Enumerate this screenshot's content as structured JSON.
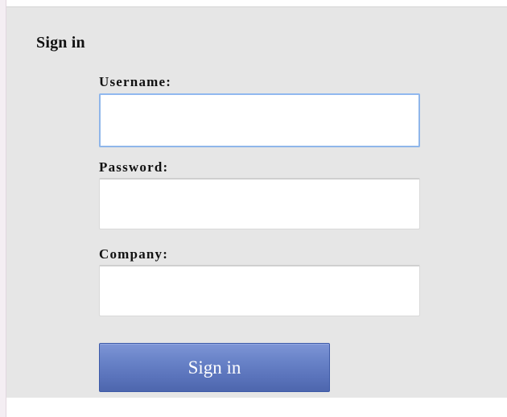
{
  "form": {
    "title": "Sign in",
    "fields": {
      "username": {
        "label": "Username:",
        "value": "",
        "placeholder": ""
      },
      "password": {
        "label": "Password:",
        "value": "",
        "placeholder": ""
      },
      "company": {
        "label": "Company:",
        "value": "",
        "placeholder": ""
      }
    },
    "submit_label": "Sign in"
  },
  "colors": {
    "panel_background": "#e6e6e6",
    "input_background": "#ffffff",
    "focused_input_border": "#8fb6ea",
    "button_top": "#7e95d6",
    "button_bottom": "#4d66ad",
    "button_text": "#ffffff"
  }
}
